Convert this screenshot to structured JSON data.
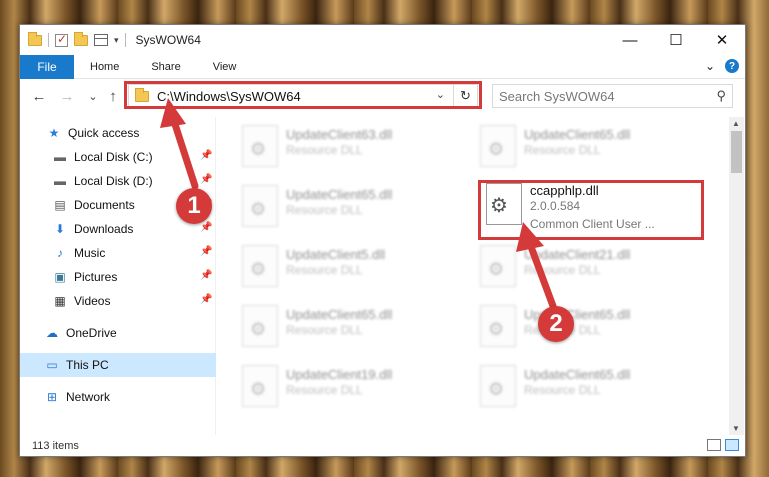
{
  "window": {
    "title": "SysWOW64",
    "qa_dropdown": "▾",
    "controls": {
      "minimize": "—",
      "maximize": "☐",
      "close": "✕"
    }
  },
  "ribbon": {
    "tabs": [
      "File",
      "Home",
      "Share",
      "View"
    ],
    "expand": "⌄",
    "help": "?"
  },
  "nav": {
    "back": "←",
    "forward": "→",
    "recent": "⌄",
    "up": "↑",
    "address": "C:\\Windows\\SysWOW64",
    "address_drop": "⌄",
    "refresh": "↻",
    "search_placeholder": "Search SysWOW64",
    "search_icon": "⚲"
  },
  "sidebar": {
    "items": [
      {
        "label": "Quick access",
        "icon": "star-icon",
        "glyph": "★",
        "pinned": false
      },
      {
        "label": "Local Disk (C:)",
        "icon": "drive-icon",
        "glyph": "▬",
        "pinned": true
      },
      {
        "label": "Local Disk (D:)",
        "icon": "drive-icon",
        "glyph": "▬",
        "pinned": true
      },
      {
        "label": "Documents",
        "icon": "documents-icon",
        "glyph": "▤",
        "pinned": true
      },
      {
        "label": "Downloads",
        "icon": "downloads-icon",
        "glyph": "⬇",
        "pinned": true
      },
      {
        "label": "Music",
        "icon": "music-icon",
        "glyph": "♪",
        "pinned": true
      },
      {
        "label": "Pictures",
        "icon": "pictures-icon",
        "glyph": "▣",
        "pinned": true
      },
      {
        "label": "Videos",
        "icon": "videos-icon",
        "glyph": "▦",
        "pinned": true
      },
      {
        "label": "OneDrive",
        "icon": "cloud-icon",
        "glyph": "☁",
        "pinned": false
      },
      {
        "label": "This PC",
        "icon": "computer-icon",
        "glyph": "▭",
        "pinned": false
      },
      {
        "label": "Network",
        "icon": "network-icon",
        "glyph": "⊞",
        "pinned": false
      }
    ],
    "pin_glyph": "📌"
  },
  "files": {
    "left": [
      {
        "name": "UpdateClient63.dll",
        "type": "Resource DLL"
      },
      {
        "name": "UpdateClient65.dll",
        "type": "Resource DLL"
      },
      {
        "name": "UpdateClient5.dll",
        "type": "Resource DLL"
      },
      {
        "name": "UpdateClient65.dll",
        "type": "Resource DLL"
      },
      {
        "name": "UpdateClient19.dll",
        "type": "Resource DLL"
      }
    ],
    "right": [
      {
        "name": "UpdateClient65.dll",
        "type": "Resource DLL"
      },
      {
        "name": "UpdateClient21.dll",
        "type": "Resource DLL"
      },
      {
        "name": "UpdateClient65.dll",
        "type": "Resource DLL"
      },
      {
        "name": "UpdateClient65.dll",
        "type": "Resource DLL"
      }
    ],
    "highlighted": {
      "name": "ccapphlp.dll",
      "version": "2.0.0.584",
      "description": "Common Client User ..."
    },
    "gear_glyph": "⚙"
  },
  "status": {
    "count": "113 items"
  },
  "annotations": {
    "step1": "1",
    "step2": "2",
    "color": "#d43a3a"
  }
}
